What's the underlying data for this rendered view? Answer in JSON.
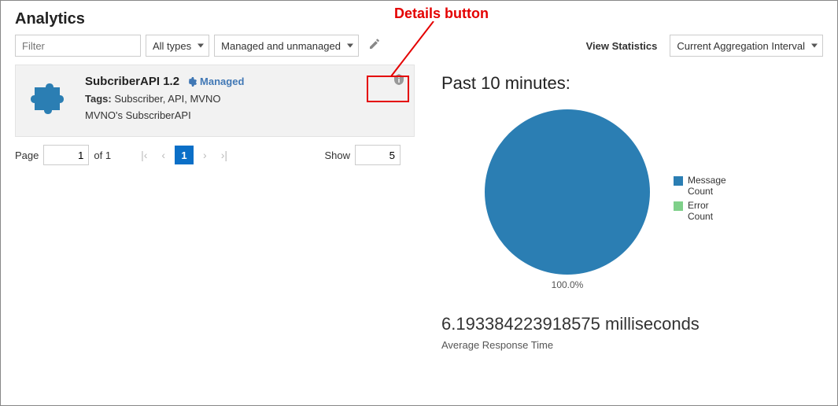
{
  "page": {
    "title": "Analytics"
  },
  "toolbar": {
    "filter_placeholder": "Filter",
    "types_label": "All types",
    "managed_label": "Managed and unmanaged",
    "view_stats_label": "View Statistics",
    "interval_label": "Current Aggregation Interval"
  },
  "card": {
    "title": "SubcriberAPI 1.2",
    "managed_label": "Managed",
    "tags_label": "Tags:",
    "tags_value": "Subscriber, API, MVNO",
    "description": "MVNO's SubscriberAPI"
  },
  "pager": {
    "page_label": "Page",
    "page_value": "1",
    "of_label": "of 1",
    "current": "1",
    "show_label": "Show",
    "show_value": "5"
  },
  "stats": {
    "past_title": "Past 10 minutes:",
    "pie_percent": "100.0%",
    "legend_msg": "Message\nCount",
    "legend_err": "Error\nCount",
    "rt_value": "6.193384223918575 milliseconds",
    "rt_label": "Average Response Time"
  },
  "annotation": {
    "label": "Details button"
  },
  "chart_data": {
    "type": "pie",
    "title": "Past 10 minutes:",
    "series": [
      {
        "name": "Message Count",
        "value": 100.0,
        "color": "#2b7eb3"
      },
      {
        "name": "Error Count",
        "value": 0.0,
        "color": "#7fd08a"
      }
    ],
    "labels": [
      "100.0%"
    ]
  }
}
